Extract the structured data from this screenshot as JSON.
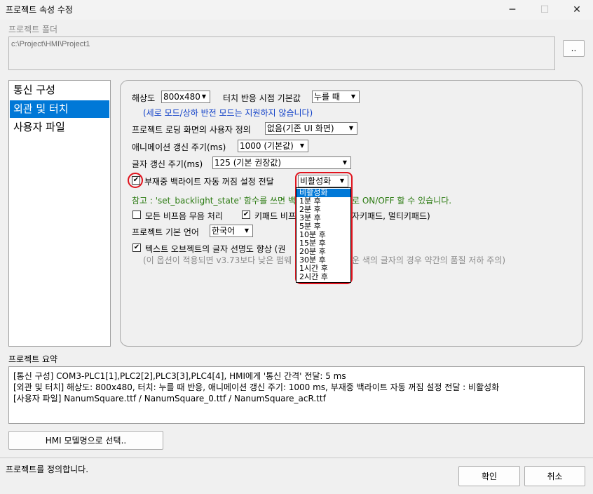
{
  "window": {
    "title": "프로젝트 속성 수정"
  },
  "folder": {
    "label": "프로젝트 폴더",
    "path": "c:\\Project\\HMI\\Project1",
    "browse_label": ".."
  },
  "nav": {
    "items": [
      {
        "label": "통신 구성"
      },
      {
        "label": "외관 및 터치",
        "selected": true
      },
      {
        "label": "사용자 파일"
      }
    ]
  },
  "settings": {
    "resolution_label": "해상도",
    "resolution_value": "800x480",
    "touch_label": "터치 반응 시점 기본값",
    "touch_value": "누를 때",
    "resolution_note": "(세로 모드/상하 반전 모드는 지원하지 않습니다)",
    "loading_label": "프로젝트 로딩 화면의 사용자 정의",
    "loading_value": "없음(기존 UI 화면)",
    "animation_label": "애니메이션 갱신 주기(ms)",
    "animation_value": "1000 (기본값)",
    "text_refresh_label": "글자 갱신 주기(ms)",
    "text_refresh_value": "125 (기본 권장값)",
    "backlight_label": "부재중 백라이트 자동 꺼짐 설정 전달",
    "backlight_checked": true,
    "backlight_value": "비활성화",
    "backlight_note_left": "참고 : 'set_backlight_state' 함수를 쓰면 백",
    "backlight_note_right": "로 ON/OFF 할 수 있습니다.",
    "mute_label": "모든 비프음 무음 처리",
    "mute_checked": false,
    "keypad_label_left": "키패드 비프",
    "keypad_label_right": "자키패드, 멀티키패드)",
    "keypad_checked": true,
    "language_label": "프로젝트 기본 언어",
    "language_value": "한국어",
    "antialias_label": "텍스트 오브젝트의 글자 선명도 향상 (권",
    "antialias_checked": true,
    "antialias_note_left": "(이 옵션이 적용되면 v3.73보다 낮은 펌웨",
    "antialias_note_right": "운 색의 글자의 경우 약간의 품질 저하 주의)"
  },
  "backlight_dropdown": {
    "options": [
      "비활성화",
      "1분 후",
      "2분 후",
      "3분 후",
      "5분 후",
      "10분 후",
      "15분 후",
      "20분 후",
      "30분 후",
      "1시간 후",
      "2시간 후"
    ],
    "selected_index": 0
  },
  "summary": {
    "label": "프로젝트 요약",
    "lines": [
      "[통신 구성] COM3-PLC1[1],PLC2[2],PLC3[3],PLC4[4], HMI에게 '통신 간격' 전달: 5 ms",
      "[외관 및 터치] 해상도: 800x480, 터치: 누를 때 반응, 애니메이션 갱신 주기: 1000 ms, 부재중 백라이트 자동 꺼짐 설정 전달 : 비활성화",
      "[사용자 파일] NanumSquare.ttf / NanumSquare_0.ttf / NanumSquare_acR.ttf"
    ]
  },
  "model_button_label": "HMI 모델명으로 선택..",
  "status_text": "프로젝트를 정의합니다.",
  "ok_label": "확인",
  "cancel_label": "취소",
  "colors": {
    "accent": "#0078d7",
    "highlight_ring": "#e0141e",
    "note_blue": "#1040c8",
    "note_green": "#2a7a10"
  }
}
